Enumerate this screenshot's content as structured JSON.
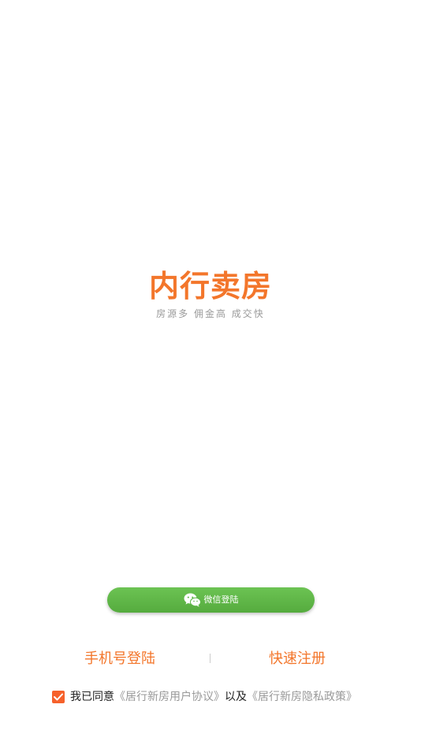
{
  "logo": {
    "title": "内行卖房",
    "slogan": "房源多 佣金高 成交快"
  },
  "wechat_login": {
    "label": "微信登陆",
    "icon": "wechat-icon"
  },
  "links": {
    "phone_login": "手机号登陆",
    "quick_register": "快速注册"
  },
  "agreement": {
    "checked": true,
    "prefix": "我已同意",
    "user_agreement": "《居行新房用户协议》",
    "connector": "以及",
    "privacy_policy": "《居行新房隐私政策》"
  },
  "colors": {
    "brand_orange": "#f3762b",
    "wechat_green": "#5cb645",
    "checkbox": "#f6612b",
    "link_gray": "#999999"
  }
}
